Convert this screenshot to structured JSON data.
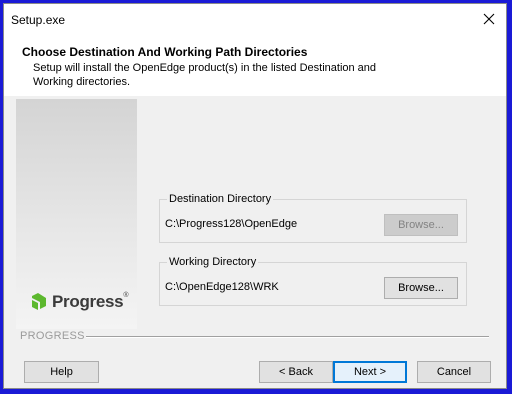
{
  "window": {
    "title": "Setup.exe"
  },
  "header": {
    "title": "Choose Destination And Working Path Directories",
    "subtitle": "Setup will install the OpenEdge product(s) in the listed Destination and Working directories."
  },
  "logo": {
    "text": "Progress",
    "reg": "®",
    "color": "#5cb82e"
  },
  "destination": {
    "label": "Destination Directory",
    "path": "C:\\Progress128\\OpenEdge",
    "browse_label": "Browse...",
    "browse_enabled": false
  },
  "working": {
    "label": "Working Directory",
    "path": "C:\\OpenEdge128\\WRK",
    "browse_label": "Browse...",
    "browse_enabled": true
  },
  "separator_label": "PROGRESS",
  "buttons": {
    "help": "Help",
    "back": "< Back",
    "next": "Next >",
    "cancel": "Cancel"
  },
  "icons": {
    "close": "close-icon",
    "logo": "progress-logo-icon"
  },
  "colors": {
    "desktop": "#1a1ad6",
    "accent": "#0078d7"
  }
}
